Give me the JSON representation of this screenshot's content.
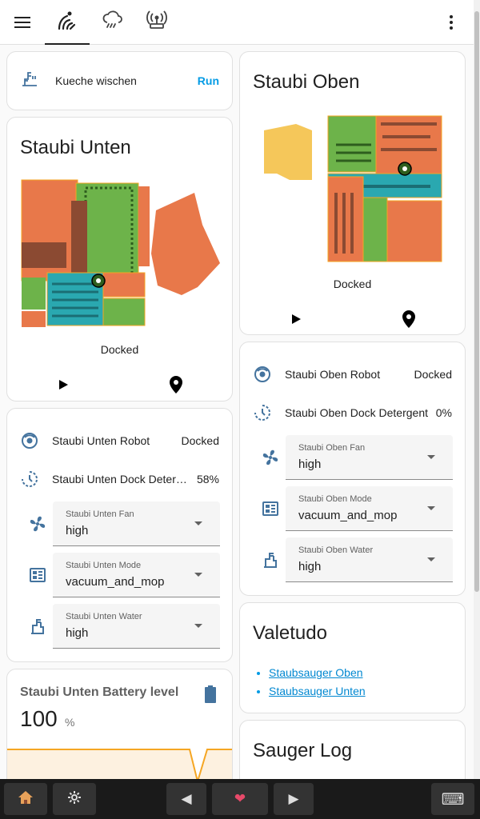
{
  "topbar": {
    "menu_icon": "hamburger-menu-icon",
    "tabs": [
      {
        "icon": "robot-vacuum-icon",
        "active": true
      },
      {
        "icon": "weather-rainy-icon",
        "active": false
      },
      {
        "icon": "access-point-network-icon",
        "active": false
      }
    ],
    "overflow_icon": "dots-vertical-icon"
  },
  "script_card": {
    "icon": "water-pump-icon",
    "name": "Kueche wischen",
    "action": "Run"
  },
  "vac_unten": {
    "title": "Staubi Unten",
    "status": "Docked",
    "buttons": [
      {
        "icon": "play-icon"
      },
      {
        "icon": "map-marker-icon"
      }
    ]
  },
  "vac_oben": {
    "title": "Staubi Oben",
    "status": "Docked",
    "buttons": [
      {
        "icon": "play-icon"
      },
      {
        "icon": "map-marker-icon"
      }
    ]
  },
  "unten_entities": {
    "robot": {
      "name": "Staubi Unten Robot",
      "state": "Docked"
    },
    "detergent": {
      "name": "Staubi Unten Dock Detergent",
      "state": "58%"
    },
    "fan": {
      "label": "Staubi Unten Fan",
      "value": "high"
    },
    "mode": {
      "label": "Staubi Unten Mode",
      "value": "vacuum_and_mop"
    },
    "water": {
      "label": "Staubi Unten Water",
      "value": "high"
    }
  },
  "oben_entities": {
    "robot": {
      "name": "Staubi Oben Robot",
      "state": "Docked"
    },
    "detergent": {
      "name": "Staubi Oben Dock Detergent",
      "state": "0%"
    },
    "fan": {
      "label": "Staubi Oben Fan",
      "value": "high"
    },
    "mode": {
      "label": "Staubi Oben Mode",
      "value": "vacuum_and_mop"
    },
    "water": {
      "label": "Staubi Oben Water",
      "value": "high"
    }
  },
  "battery": {
    "title": "Staubi Unten Battery level",
    "value": "100",
    "unit": "%",
    "icon": "battery-icon"
  },
  "valetudo": {
    "title": "Valetudo",
    "links": [
      "Staubsauger Oben",
      "Staubsauger Unten"
    ]
  },
  "sauger_log": {
    "title": "Sauger Log"
  },
  "bottom_bar": {
    "home_icon": "house-emoji",
    "settings_icon": "gear",
    "prev_icon": "◀",
    "heart_icon": "❤",
    "next_icon": "▶",
    "keyboard_icon": "⌨"
  },
  "colors": {
    "accent": "#039be5",
    "map_orange": "#e8784a",
    "map_green": "#6db34a",
    "map_teal": "#2aa8b0",
    "map_yellow": "#f5c75a"
  }
}
